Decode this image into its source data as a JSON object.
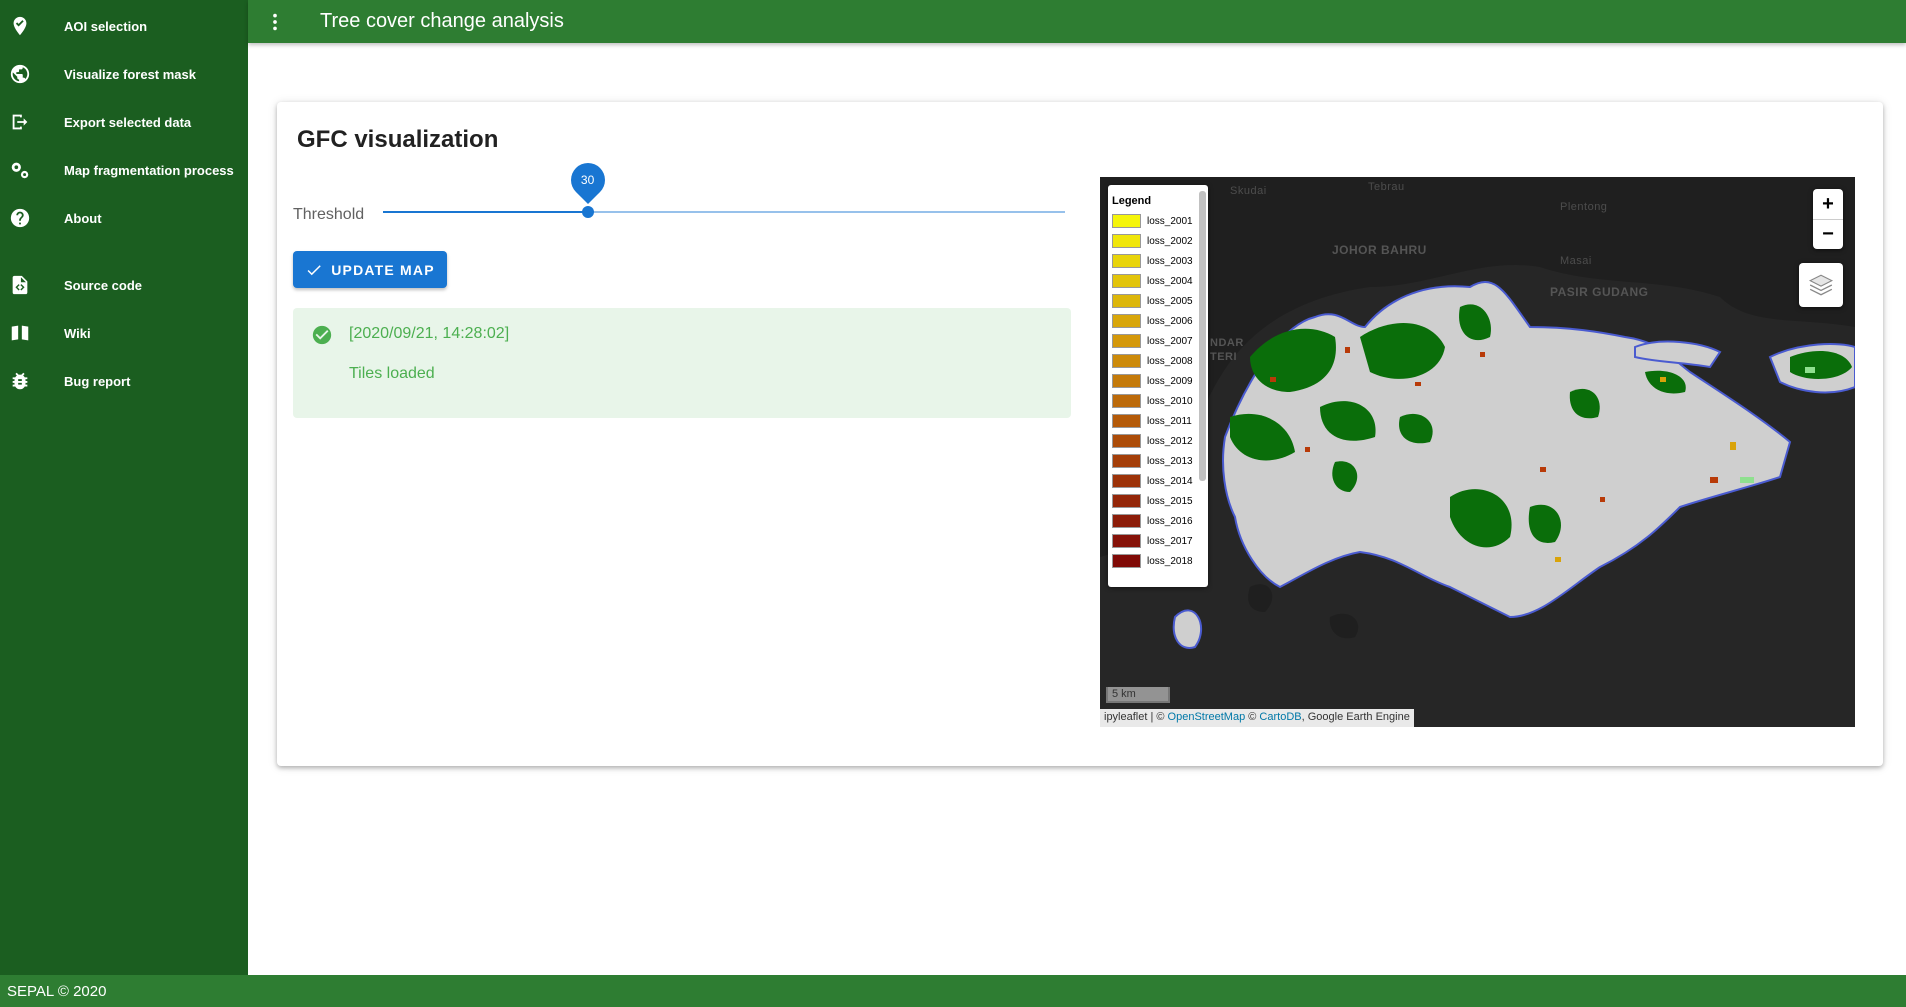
{
  "app": {
    "title": "Tree cover change analysis",
    "footer": "SEPAL © 2020"
  },
  "sidebar": {
    "items": [
      {
        "label": "AOI selection",
        "icon": "map-marker-check-icon"
      },
      {
        "label": "Visualize forest mask",
        "icon": "globe-icon"
      },
      {
        "label": "Export selected data",
        "icon": "export-icon"
      },
      {
        "label": "Map fragmentation process",
        "icon": "cogs-icon"
      },
      {
        "label": "About",
        "icon": "help-circle-icon"
      }
    ],
    "links": [
      {
        "label": "Source code",
        "icon": "file-code-icon"
      },
      {
        "label": "Wiki",
        "icon": "book-icon"
      },
      {
        "label": "Bug report",
        "icon": "bug-icon"
      }
    ]
  },
  "card": {
    "title": "GFC visualization",
    "threshold_label": "Threshold",
    "threshold_value": "30",
    "threshold_fraction": 0.3,
    "button_label": "UPDATE MAP",
    "alert": {
      "timestamp": "[2020/09/21, 14:28:02]",
      "message": "Tiles loaded"
    }
  },
  "map": {
    "place_labels": [
      "Skudai",
      "Tebrau",
      "Plentong",
      "JOHOR BAHRU",
      "Masai",
      "PASIR GUDANG",
      "NDAR",
      "TERI"
    ],
    "legend_title": "Legend",
    "legend": [
      {
        "label": "loss_2001",
        "color": "#f5f50a"
      },
      {
        "label": "loss_2002",
        "color": "#f0e60a"
      },
      {
        "label": "loss_2003",
        "color": "#e8d40a"
      },
      {
        "label": "loss_2004",
        "color": "#e2c40a"
      },
      {
        "label": "loss_2005",
        "color": "#dcb60a"
      },
      {
        "label": "loss_2006",
        "color": "#d8a60a"
      },
      {
        "label": "loss_2007",
        "color": "#d4980a"
      },
      {
        "label": "loss_2008",
        "color": "#cc8a0a"
      },
      {
        "label": "loss_2009",
        "color": "#c47a0a"
      },
      {
        "label": "loss_2010",
        "color": "#bc6a0a"
      },
      {
        "label": "loss_2011",
        "color": "#b45a08"
      },
      {
        "label": "loss_2012",
        "color": "#ac4c08"
      },
      {
        "label": "loss_2013",
        "color": "#a43e08"
      },
      {
        "label": "loss_2014",
        "color": "#9c3208"
      },
      {
        "label": "loss_2015",
        "color": "#942608"
      },
      {
        "label": "loss_2016",
        "color": "#8c1c08"
      },
      {
        "label": "loss_2017",
        "color": "#861208"
      },
      {
        "label": "loss_2018",
        "color": "#800a06"
      }
    ],
    "zoom_in": "+",
    "zoom_out": "−",
    "scale": "5 km",
    "attribution": {
      "prefix": "ipyleaflet | © ",
      "osm": "OpenStreetMap",
      "mid": " © ",
      "carto": "CartoDB",
      "suffix": ", Google Earth Engine"
    }
  },
  "colors": {
    "sidebar": "#1b5e20",
    "appbar": "#2e7d32",
    "primary": "#1976d2",
    "success": "#4caf50",
    "forest": "#0a6e0a",
    "land": "#cfcfcf"
  }
}
